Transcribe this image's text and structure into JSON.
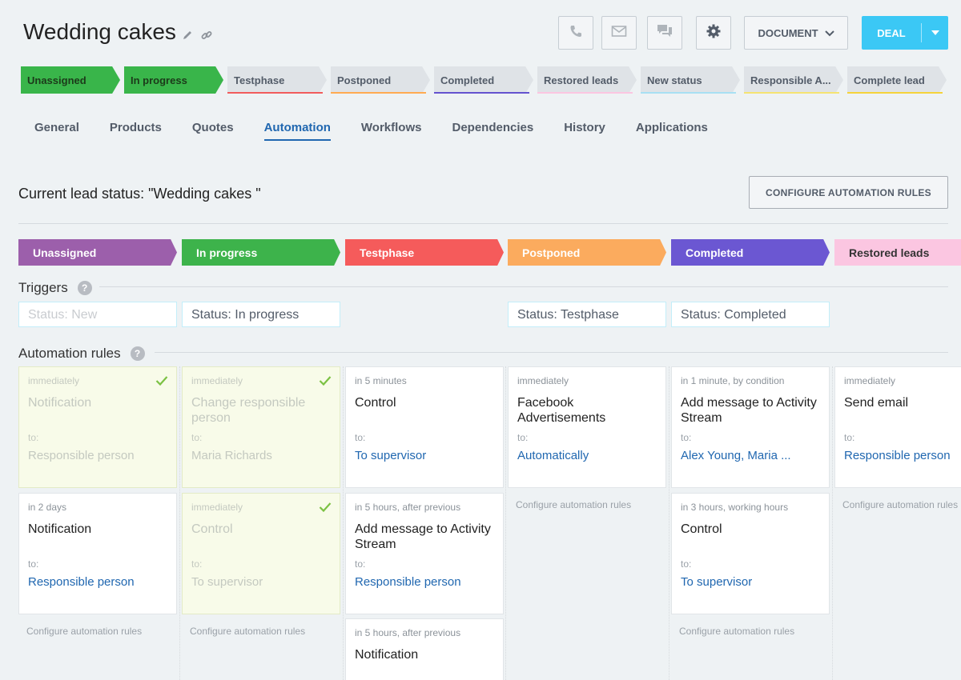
{
  "header": {
    "title": "Wedding cakes",
    "document_label": "DOCUMENT",
    "deal_label": "DEAL",
    "icons": [
      "pencil-icon",
      "link-icon",
      "phone-icon",
      "mail-icon",
      "chat-icon",
      "gear-icon"
    ]
  },
  "statusbar": [
    {
      "label": "Unassigned",
      "color": "#39b54a",
      "underline": "#39b54a",
      "active": true
    },
    {
      "label": "In progress",
      "color": "#39b54a",
      "underline": "#39b54a",
      "active": true
    },
    {
      "label": "Testphase",
      "color": "#dfe3e7",
      "underline": "#f15c5c",
      "active": false
    },
    {
      "label": "Postponed",
      "color": "#dfe3e7",
      "underline": "#ffab52",
      "active": false
    },
    {
      "label": "Completed",
      "color": "#dfe3e7",
      "underline": "#6453cf",
      "active": false
    },
    {
      "label": "Restored leads",
      "color": "#dfe3e7",
      "underline": "#fbc6e1",
      "active": false
    },
    {
      "label": "New status",
      "color": "#dfe3e7",
      "underline": "#a8e0f3",
      "active": false
    },
    {
      "label": "Responsible A...",
      "color": "#dfe3e7",
      "underline": "#f5e472",
      "active": false
    },
    {
      "label": "Complete lead",
      "color": "#dfe3e7",
      "underline": "#f5d33a",
      "active": false
    }
  ],
  "tabs": [
    {
      "label": "General",
      "active": false
    },
    {
      "label": "Products",
      "active": false
    },
    {
      "label": "Quotes",
      "active": false
    },
    {
      "label": "Automation",
      "active": true
    },
    {
      "label": "Workflows",
      "active": false
    },
    {
      "label": "Dependencies",
      "active": false
    },
    {
      "label": "History",
      "active": false
    },
    {
      "label": "Applications",
      "active": false
    }
  ],
  "lead_status": "Current lead status: \"Wedding cakes \"",
  "configure_button": "CONFIGURE AUTOMATION RULES",
  "triggers_title": "Triggers",
  "rules_title": "Automation rules",
  "help_mark": "?",
  "to_label": "to:",
  "configure_link": "Configure automation rules",
  "columns": [
    {
      "stage": "Unassigned",
      "color": "#9c5fab",
      "trigger": "Status: New",
      "trigger_muted": true,
      "cards": [
        {
          "when": "immediately",
          "name": "Notification",
          "recipient": "Responsible person",
          "done": true
        },
        {
          "when": "in 2 days",
          "name": "Notification",
          "recipient": "Responsible person",
          "done": false
        }
      ]
    },
    {
      "stage": "In progress",
      "color": "#3db34b",
      "trigger": "Status: In progress",
      "trigger_muted": false,
      "cards": [
        {
          "when": "immediately",
          "name": "Change responsible person",
          "recipient": "Maria Richards",
          "done": true
        },
        {
          "when": "immediately",
          "name": "Control",
          "recipient": "To supervisor",
          "done": true
        }
      ]
    },
    {
      "stage": "Testphase",
      "color": "#f55b5b",
      "trigger": "",
      "trigger_muted": false,
      "cards": [
        {
          "when": "in 5 minutes",
          "name": "Control",
          "recipient": "To supervisor",
          "done": false
        },
        {
          "when": "in 5 hours, after previous",
          "name": "Add message to Activity Stream",
          "recipient": "Responsible person",
          "done": false
        },
        {
          "when": "in 5 hours, after previous",
          "name": "Notification",
          "recipient": "",
          "done": false
        }
      ]
    },
    {
      "stage": "Postponed",
      "color": "#fbab5e",
      "trigger": "Status: Testphase",
      "trigger_muted": false,
      "cards": [
        {
          "when": "immediately",
          "name": "Facebook Advertisements",
          "recipient": "Automatically",
          "done": false
        }
      ]
    },
    {
      "stage": "Completed",
      "color": "#6b57d2",
      "trigger": "Status: Completed",
      "trigger_muted": false,
      "cards": [
        {
          "when": "in 1 minute, by condition",
          "name": "Add message to Activity Stream",
          "recipient": "Alex Young, Maria ...",
          "done": false
        },
        {
          "when": "in 3 hours, working hours",
          "name": "Control",
          "recipient": "To supervisor",
          "done": false
        }
      ]
    },
    {
      "stage": "Restored leads",
      "color": "#fbc6e1",
      "trigger": "",
      "trigger_muted": false,
      "cards": [
        {
          "when": "immediately",
          "name": "Send email",
          "recipient": "Responsible person",
          "done": false
        }
      ]
    }
  ]
}
